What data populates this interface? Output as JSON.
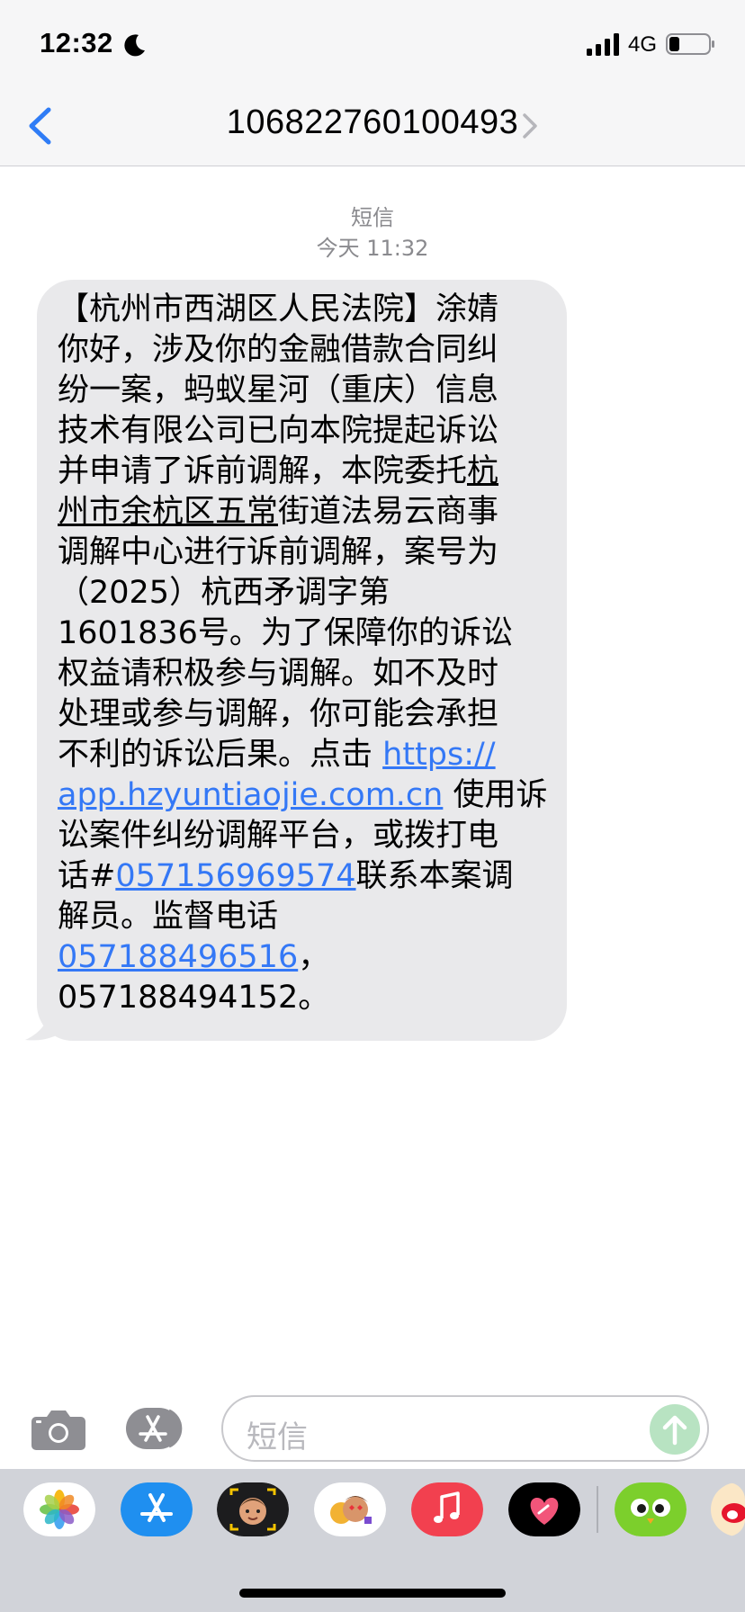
{
  "status_bar": {
    "time": "12:32",
    "network": "4G"
  },
  "nav": {
    "contact": "106822760100493"
  },
  "thread": {
    "service": "短信",
    "timestamp": "今天 11:32",
    "message": {
      "lines": [
        "【杭州市西湖区人民法院】涂婧",
        "你好，涉及你的金融借款合同纠",
        "纷一案，蚂蚁星河（重庆）信息",
        "技术有限公司已向本院提起诉讼",
        "并申请了诉前调解，本院委托",
        "州市余杭区五常",
        "调解中心进行诉前调解，案号为",
        "（2025）杭西矛调字第",
        "1601836号。为了保障你的诉讼",
        "权益请积极参与调解。如不及时",
        "处理或参与调解，你可能会承担",
        "不利的诉讼后果。点击 ",
        " 使用诉",
        "讼案件纠纷调解平台，或拨打电",
        "话#",
        "联系本案调",
        "解员。监督电话",
        "，",
        "057188494152。"
      ],
      "underlined": [
        "杭",
        "街道法易云商事"
      ],
      "link_url_1": "https://",
      "link_url_2": "app.hzyuntiaojie.com.cn",
      "link_phone_1": "057156969574",
      "link_phone_2": "057188496516"
    }
  },
  "input": {
    "placeholder": "短信"
  },
  "icons": {
    "back": "chevron-left-icon",
    "detail": "chevron-right-icon",
    "camera": "camera-icon",
    "apps": "app-store-icon",
    "send": "arrow-up-icon"
  },
  "app_drawer": {
    "apps": [
      "photos-app",
      "app-store-app",
      "memoji-app",
      "animoji-stickers-app",
      "music-app",
      "digital-touch-app",
      "duolingo-app",
      "weibo-app"
    ]
  },
  "colors": {
    "link": "#3478f6",
    "bubble": "#e9e9eb",
    "accent": "#2f7cf6"
  }
}
